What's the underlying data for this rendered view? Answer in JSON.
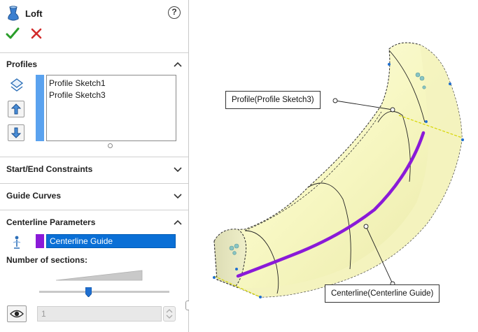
{
  "feature": {
    "title": "Loft",
    "help_label": "?"
  },
  "profiles": {
    "header": "Profiles",
    "items": [
      "Profile Sketch1",
      "Profile Sketch3"
    ]
  },
  "collapsed_sections": {
    "start_end": "Start/End Constraints",
    "guide_curves": "Guide Curves"
  },
  "centerline": {
    "header": "Centerline Parameters",
    "selected": "Centerline Guide",
    "number_of_sections_label": "Number of sections:",
    "sections_value": "1",
    "slider_position": 0.38
  },
  "viewport": {
    "callout_profile": "Profile(Profile Sketch3)",
    "callout_centerline": "Centerline(Centerline Guide)"
  },
  "colors": {
    "accept_green": "#2a9d2a",
    "cancel_red": "#d22b2b",
    "profile_bar_blue": "#5aa2ef",
    "centerline_purple": "#8a1ad8",
    "selection_blue": "#0a6fd6",
    "surface_yellow": "#fbfbd4"
  }
}
